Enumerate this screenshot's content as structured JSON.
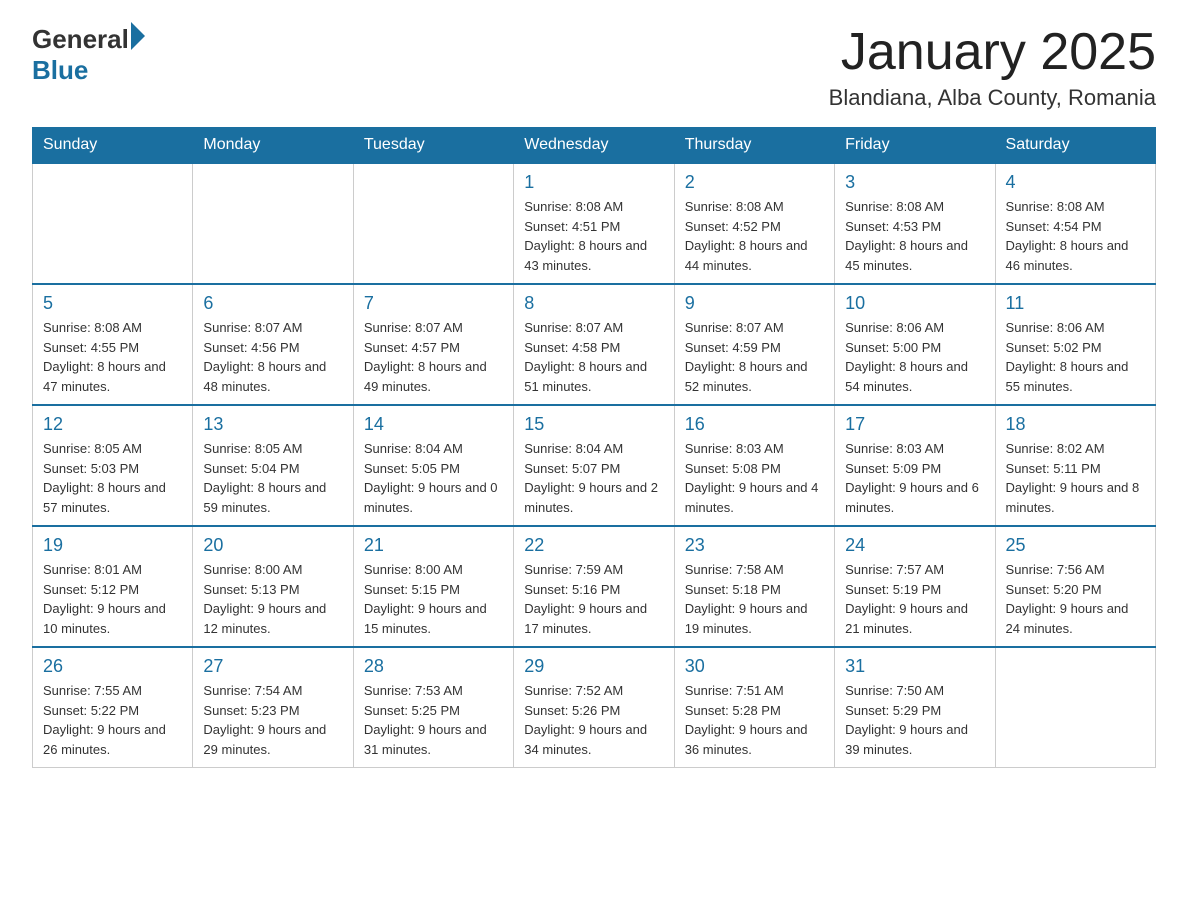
{
  "logo": {
    "general": "General",
    "blue": "Blue"
  },
  "title": "January 2025",
  "subtitle": "Blandiana, Alba County, Romania",
  "days_of_week": [
    "Sunday",
    "Monday",
    "Tuesday",
    "Wednesday",
    "Thursday",
    "Friday",
    "Saturday"
  ],
  "weeks": [
    [
      {
        "day": "",
        "info": ""
      },
      {
        "day": "",
        "info": ""
      },
      {
        "day": "",
        "info": ""
      },
      {
        "day": "1",
        "info": "Sunrise: 8:08 AM\nSunset: 4:51 PM\nDaylight: 8 hours and 43 minutes."
      },
      {
        "day": "2",
        "info": "Sunrise: 8:08 AM\nSunset: 4:52 PM\nDaylight: 8 hours and 44 minutes."
      },
      {
        "day": "3",
        "info": "Sunrise: 8:08 AM\nSunset: 4:53 PM\nDaylight: 8 hours and 45 minutes."
      },
      {
        "day": "4",
        "info": "Sunrise: 8:08 AM\nSunset: 4:54 PM\nDaylight: 8 hours and 46 minutes."
      }
    ],
    [
      {
        "day": "5",
        "info": "Sunrise: 8:08 AM\nSunset: 4:55 PM\nDaylight: 8 hours and 47 minutes."
      },
      {
        "day": "6",
        "info": "Sunrise: 8:07 AM\nSunset: 4:56 PM\nDaylight: 8 hours and 48 minutes."
      },
      {
        "day": "7",
        "info": "Sunrise: 8:07 AM\nSunset: 4:57 PM\nDaylight: 8 hours and 49 minutes."
      },
      {
        "day": "8",
        "info": "Sunrise: 8:07 AM\nSunset: 4:58 PM\nDaylight: 8 hours and 51 minutes."
      },
      {
        "day": "9",
        "info": "Sunrise: 8:07 AM\nSunset: 4:59 PM\nDaylight: 8 hours and 52 minutes."
      },
      {
        "day": "10",
        "info": "Sunrise: 8:06 AM\nSunset: 5:00 PM\nDaylight: 8 hours and 54 minutes."
      },
      {
        "day": "11",
        "info": "Sunrise: 8:06 AM\nSunset: 5:02 PM\nDaylight: 8 hours and 55 minutes."
      }
    ],
    [
      {
        "day": "12",
        "info": "Sunrise: 8:05 AM\nSunset: 5:03 PM\nDaylight: 8 hours and 57 minutes."
      },
      {
        "day": "13",
        "info": "Sunrise: 8:05 AM\nSunset: 5:04 PM\nDaylight: 8 hours and 59 minutes."
      },
      {
        "day": "14",
        "info": "Sunrise: 8:04 AM\nSunset: 5:05 PM\nDaylight: 9 hours and 0 minutes."
      },
      {
        "day": "15",
        "info": "Sunrise: 8:04 AM\nSunset: 5:07 PM\nDaylight: 9 hours and 2 minutes."
      },
      {
        "day": "16",
        "info": "Sunrise: 8:03 AM\nSunset: 5:08 PM\nDaylight: 9 hours and 4 minutes."
      },
      {
        "day": "17",
        "info": "Sunrise: 8:03 AM\nSunset: 5:09 PM\nDaylight: 9 hours and 6 minutes."
      },
      {
        "day": "18",
        "info": "Sunrise: 8:02 AM\nSunset: 5:11 PM\nDaylight: 9 hours and 8 minutes."
      }
    ],
    [
      {
        "day": "19",
        "info": "Sunrise: 8:01 AM\nSunset: 5:12 PM\nDaylight: 9 hours and 10 minutes."
      },
      {
        "day": "20",
        "info": "Sunrise: 8:00 AM\nSunset: 5:13 PM\nDaylight: 9 hours and 12 minutes."
      },
      {
        "day": "21",
        "info": "Sunrise: 8:00 AM\nSunset: 5:15 PM\nDaylight: 9 hours and 15 minutes."
      },
      {
        "day": "22",
        "info": "Sunrise: 7:59 AM\nSunset: 5:16 PM\nDaylight: 9 hours and 17 minutes."
      },
      {
        "day": "23",
        "info": "Sunrise: 7:58 AM\nSunset: 5:18 PM\nDaylight: 9 hours and 19 minutes."
      },
      {
        "day": "24",
        "info": "Sunrise: 7:57 AM\nSunset: 5:19 PM\nDaylight: 9 hours and 21 minutes."
      },
      {
        "day": "25",
        "info": "Sunrise: 7:56 AM\nSunset: 5:20 PM\nDaylight: 9 hours and 24 minutes."
      }
    ],
    [
      {
        "day": "26",
        "info": "Sunrise: 7:55 AM\nSunset: 5:22 PM\nDaylight: 9 hours and 26 minutes."
      },
      {
        "day": "27",
        "info": "Sunrise: 7:54 AM\nSunset: 5:23 PM\nDaylight: 9 hours and 29 minutes."
      },
      {
        "day": "28",
        "info": "Sunrise: 7:53 AM\nSunset: 5:25 PM\nDaylight: 9 hours and 31 minutes."
      },
      {
        "day": "29",
        "info": "Sunrise: 7:52 AM\nSunset: 5:26 PM\nDaylight: 9 hours and 34 minutes."
      },
      {
        "day": "30",
        "info": "Sunrise: 7:51 AM\nSunset: 5:28 PM\nDaylight: 9 hours and 36 minutes."
      },
      {
        "day": "31",
        "info": "Sunrise: 7:50 AM\nSunset: 5:29 PM\nDaylight: 9 hours and 39 minutes."
      },
      {
        "day": "",
        "info": ""
      }
    ]
  ]
}
